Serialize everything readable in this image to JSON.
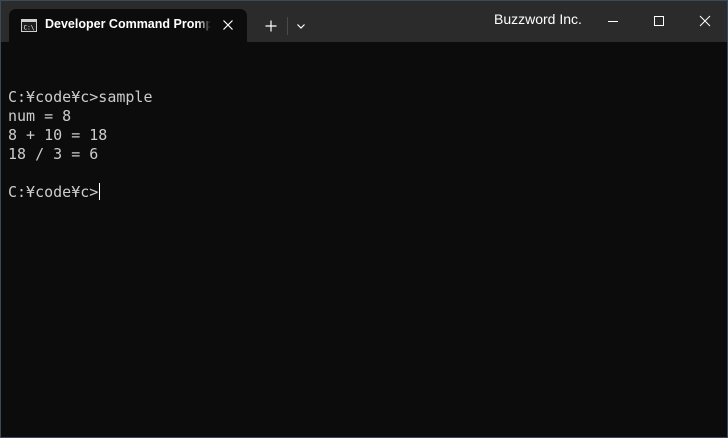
{
  "window": {
    "tab_title": "Developer Command Prompt for VS",
    "brand": "Buzzword Inc.",
    "icons": {
      "tab": "command-prompt-icon",
      "close_tab": "close-icon",
      "new_tab": "plus-icon",
      "dropdown": "chevron-down-icon",
      "minimize": "minimize-icon",
      "maximize": "maximize-icon",
      "close_window": "close-icon"
    }
  },
  "terminal": {
    "lines": [
      "",
      "C:¥code¥c>sample",
      "num = 8",
      "8 + 10 = 18",
      "18 / 3 = 6",
      "",
      "C:¥code¥c>"
    ],
    "colors": {
      "background": "#0c0c0c",
      "text": "#cccccc"
    }
  }
}
